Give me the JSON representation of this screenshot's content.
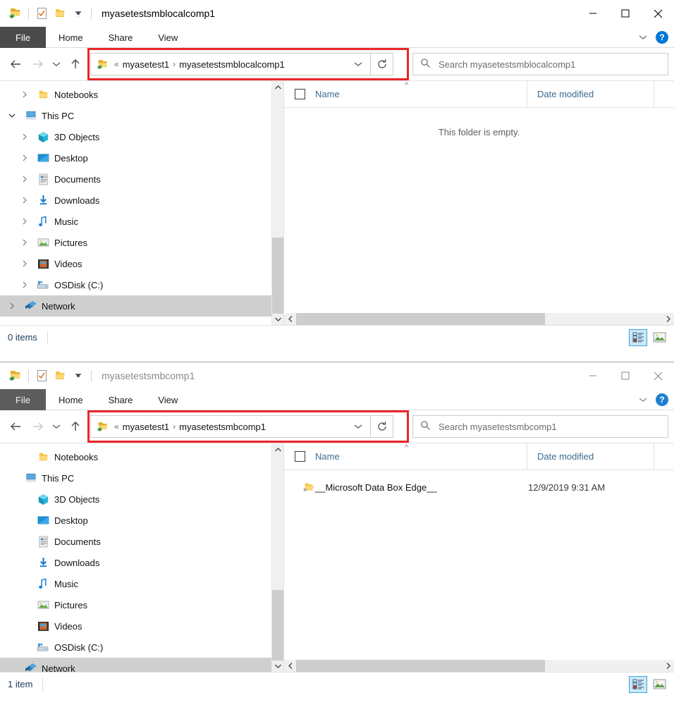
{
  "windows": [
    {
      "id": "window-1",
      "active": true,
      "title": "myasetestsmblocalcomp1",
      "quick_access": [
        "network-folder-icon",
        "properties-checkbox-icon",
        "new-folder-icon",
        "customize-qat-dropdown-icon"
      ],
      "controls": {
        "minimize": "minimize-icon",
        "maximize": "maximize-icon",
        "close": "close-icon"
      },
      "ribbon": {
        "tabs": [
          "File",
          "Home",
          "Share",
          "View"
        ],
        "collapse_icon": "chevron-down-icon",
        "help_label": "?"
      },
      "nav": {
        "back_icon": "back-arrow-icon",
        "forward_icon": "forward-arrow-icon",
        "recent_icon": "recent-locations-chevron-icon",
        "up_icon": "up-arrow-icon"
      },
      "address": {
        "highlighted": true,
        "highlight_color": "#e8262a",
        "folder_icon": "network-folder-icon",
        "overflow": "«",
        "crumbs": [
          "myasetest1",
          "myasetestsmblocalcomp1"
        ],
        "separator": "›",
        "dropdown_icon": "chevron-down-icon",
        "refresh_icon": "refresh-icon"
      },
      "search": {
        "icon": "search-icon",
        "placeholder": "Search myasetestsmblocalcomp1"
      },
      "sidebar": {
        "show_chevrons": true,
        "items": [
          {
            "label": "Notebooks",
            "icon": "folder-icon",
            "indent": 1,
            "twist": "chevron-right",
            "selected": false
          },
          {
            "label": "This PC",
            "icon": "this-pc-icon",
            "indent": 0,
            "twist": "chevron-down",
            "selected": false
          },
          {
            "label": "3D Objects",
            "icon": "3d-objects-icon",
            "indent": 1,
            "twist": "chevron-right",
            "selected": false
          },
          {
            "label": "Desktop",
            "icon": "desktop-icon",
            "indent": 1,
            "twist": "chevron-right",
            "selected": false
          },
          {
            "label": "Documents",
            "icon": "documents-icon",
            "indent": 1,
            "twist": "chevron-right",
            "selected": false
          },
          {
            "label": "Downloads",
            "icon": "downloads-icon",
            "indent": 1,
            "twist": "chevron-right",
            "selected": false
          },
          {
            "label": "Music",
            "icon": "music-icon",
            "indent": 1,
            "twist": "chevron-right",
            "selected": false
          },
          {
            "label": "Pictures",
            "icon": "pictures-icon",
            "indent": 1,
            "twist": "chevron-right",
            "selected": false
          },
          {
            "label": "Videos",
            "icon": "videos-icon",
            "indent": 1,
            "twist": "chevron-right",
            "selected": false
          },
          {
            "label": "OSDisk (C:)",
            "icon": "disk-drive-icon",
            "indent": 1,
            "twist": "chevron-right",
            "selected": false
          },
          {
            "label": "Network",
            "icon": "network-icon",
            "indent": 0,
            "twist": "chevron-right",
            "selected": true
          }
        ]
      },
      "columns": {
        "name": "Name",
        "date_modified": "Date modified",
        "sort_indicator": "ascending"
      },
      "files": [],
      "empty_message": "This folder is empty.",
      "status": {
        "item_count": "0 items",
        "view_details_icon": "details-view-icon",
        "view_large_icons_icon": "large-icons-view-icon",
        "active_view": "details"
      }
    },
    {
      "id": "window-2",
      "active": false,
      "title": "myasetestsmbcomp1",
      "quick_access": [
        "network-folder-icon",
        "properties-checkbox-icon",
        "new-folder-icon",
        "customize-qat-dropdown-icon"
      ],
      "controls": {
        "minimize": "minimize-icon",
        "maximize": "maximize-icon",
        "close": "close-icon"
      },
      "ribbon": {
        "tabs": [
          "File",
          "Home",
          "Share",
          "View"
        ],
        "collapse_icon": "chevron-down-icon",
        "help_label": "?"
      },
      "nav": {
        "back_icon": "back-arrow-icon",
        "forward_icon": "forward-arrow-icon",
        "recent_icon": "recent-locations-chevron-icon",
        "up_icon": "up-arrow-icon"
      },
      "address": {
        "highlighted": true,
        "highlight_color": "#e8262a",
        "folder_icon": "network-folder-icon",
        "overflow": "«",
        "crumbs": [
          "myasetest1",
          "myasetestsmbcomp1"
        ],
        "separator": "›",
        "dropdown_icon": "chevron-down-icon",
        "refresh_icon": "refresh-icon"
      },
      "search": {
        "icon": "search-icon",
        "placeholder": "Search myasetestsmbcomp1"
      },
      "sidebar": {
        "show_chevrons": false,
        "items": [
          {
            "label": "Notebooks",
            "icon": "folder-icon",
            "indent": 1,
            "twist": "",
            "selected": false
          },
          {
            "label": "This PC",
            "icon": "this-pc-icon",
            "indent": 0,
            "twist": "",
            "selected": false
          },
          {
            "label": "3D Objects",
            "icon": "3d-objects-icon",
            "indent": 1,
            "twist": "",
            "selected": false
          },
          {
            "label": "Desktop",
            "icon": "desktop-icon",
            "indent": 1,
            "twist": "",
            "selected": false
          },
          {
            "label": "Documents",
            "icon": "documents-icon",
            "indent": 1,
            "twist": "",
            "selected": false
          },
          {
            "label": "Downloads",
            "icon": "downloads-icon",
            "indent": 1,
            "twist": "",
            "selected": false
          },
          {
            "label": "Music",
            "icon": "music-icon",
            "indent": 1,
            "twist": "",
            "selected": false
          },
          {
            "label": "Pictures",
            "icon": "pictures-icon",
            "indent": 1,
            "twist": "",
            "selected": false
          },
          {
            "label": "Videos",
            "icon": "videos-icon",
            "indent": 1,
            "twist": "",
            "selected": false
          },
          {
            "label": "OSDisk (C:)",
            "icon": "disk-drive-icon",
            "indent": 1,
            "twist": "",
            "selected": false
          },
          {
            "label": "Network",
            "icon": "network-icon",
            "indent": 0,
            "twist": "",
            "selected": true
          }
        ]
      },
      "columns": {
        "name": "Name",
        "date_modified": "Date modified",
        "sort_indicator": "ascending"
      },
      "files": [
        {
          "name": "__Microsoft Data Box Edge__",
          "date_modified": "12/9/2019 9:31 AM",
          "icon": "folder-shortcut-icon"
        }
      ],
      "empty_message": "",
      "status": {
        "item_count": "1 item",
        "view_details_icon": "details-view-icon",
        "view_large_icons_icon": "large-icons-view-icon",
        "active_view": "details"
      }
    }
  ]
}
